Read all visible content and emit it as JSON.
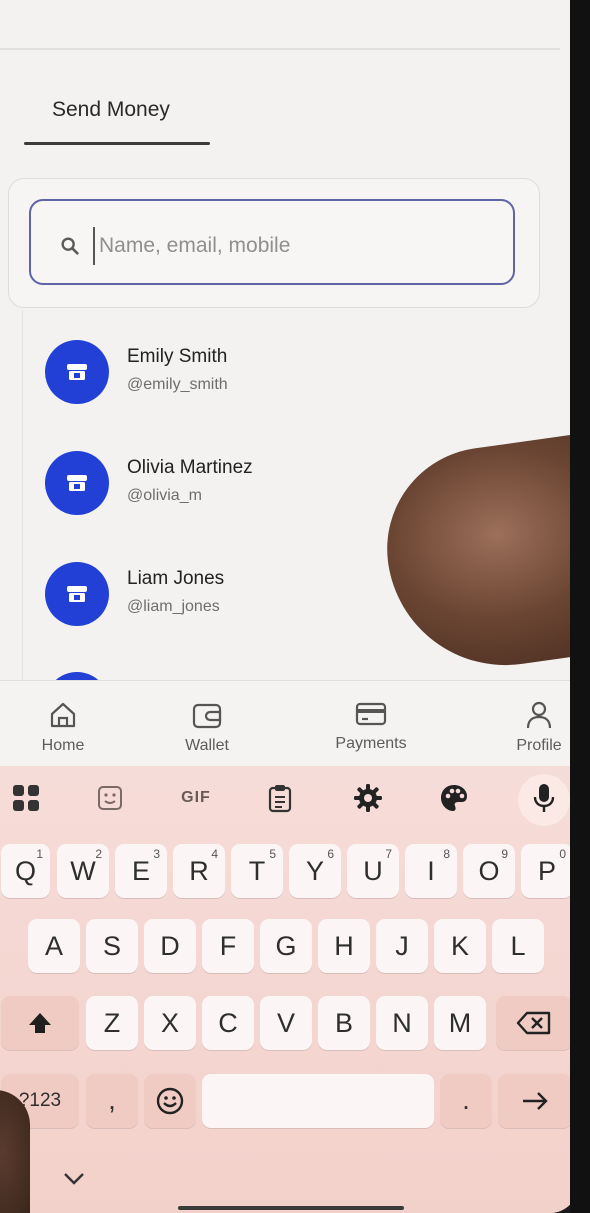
{
  "header": {
    "title": "Send Money"
  },
  "search": {
    "placeholder": "Name, email, mobile",
    "value": ""
  },
  "contacts": [
    {
      "name": "Emily Smith",
      "handle": "@emily_smith"
    },
    {
      "name": "Olivia Martinez",
      "handle": "@olivia_m"
    },
    {
      "name": "Liam Jones",
      "handle": "@liam_jones"
    }
  ],
  "nav": [
    {
      "label": "Home",
      "icon": "home-icon"
    },
    {
      "label": "Wallet",
      "icon": "wallet-icon"
    },
    {
      "label": "Payments",
      "icon": "card-icon"
    },
    {
      "label": "Profile",
      "icon": "person-icon"
    }
  ],
  "keyboard": {
    "toolbar": {
      "gif": "GIF"
    },
    "row1": [
      {
        "key": "Q",
        "hint": "1"
      },
      {
        "key": "W",
        "hint": "2"
      },
      {
        "key": "E",
        "hint": "3"
      },
      {
        "key": "R",
        "hint": "4"
      },
      {
        "key": "T",
        "hint": "5"
      },
      {
        "key": "Y",
        "hint": "6"
      },
      {
        "key": "U",
        "hint": "7"
      },
      {
        "key": "I",
        "hint": "8"
      },
      {
        "key": "O",
        "hint": "9"
      },
      {
        "key": "P",
        "hint": "0"
      }
    ],
    "row2": [
      "A",
      "S",
      "D",
      "F",
      "G",
      "H",
      "J",
      "K",
      "L"
    ],
    "row3": [
      "Z",
      "X",
      "C",
      "V",
      "B",
      "N",
      "M"
    ],
    "symbols": "?123",
    "comma": ",",
    "period": "."
  },
  "colors": {
    "accent": "#2340d6",
    "search_border": "#5f63a8",
    "keyboard_bg": "#f3d1cb"
  }
}
